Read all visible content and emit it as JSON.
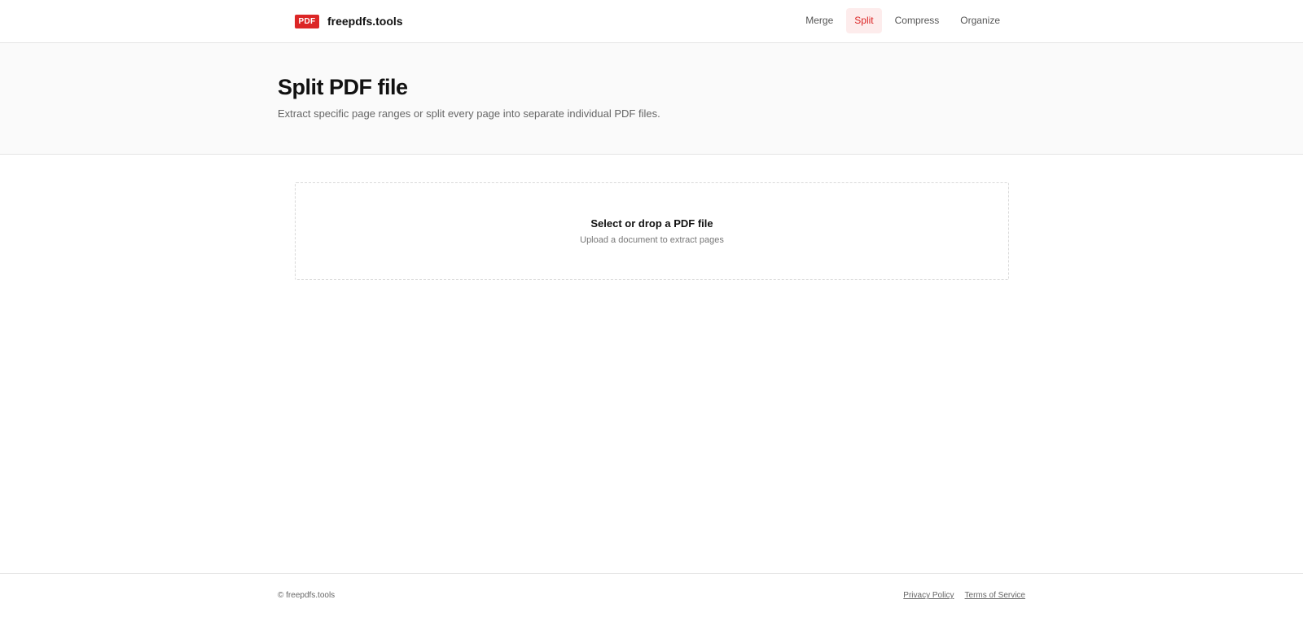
{
  "brand": {
    "badge": "PDF",
    "name": "freepdfs.tools"
  },
  "nav": {
    "items": [
      {
        "label": "Merge"
      },
      {
        "label": "Split",
        "active": true
      },
      {
        "label": "Compress"
      },
      {
        "label": "Organize"
      }
    ]
  },
  "hero": {
    "title": "Split PDF file",
    "subtitle": "Extract specific page ranges or split every page into separate individual PDF files."
  },
  "dropzone": {
    "title": "Select or drop a PDF file",
    "subtitle": "Upload a document to extract pages"
  },
  "footer": {
    "copyright": "© freepdfs.tools",
    "links": [
      {
        "label": "Privacy Policy"
      },
      {
        "label": "Terms of Service"
      }
    ]
  },
  "colors": {
    "accent": "#dc2626",
    "accent_bg": "#fdecec",
    "hero_bg": "#fafafa"
  }
}
